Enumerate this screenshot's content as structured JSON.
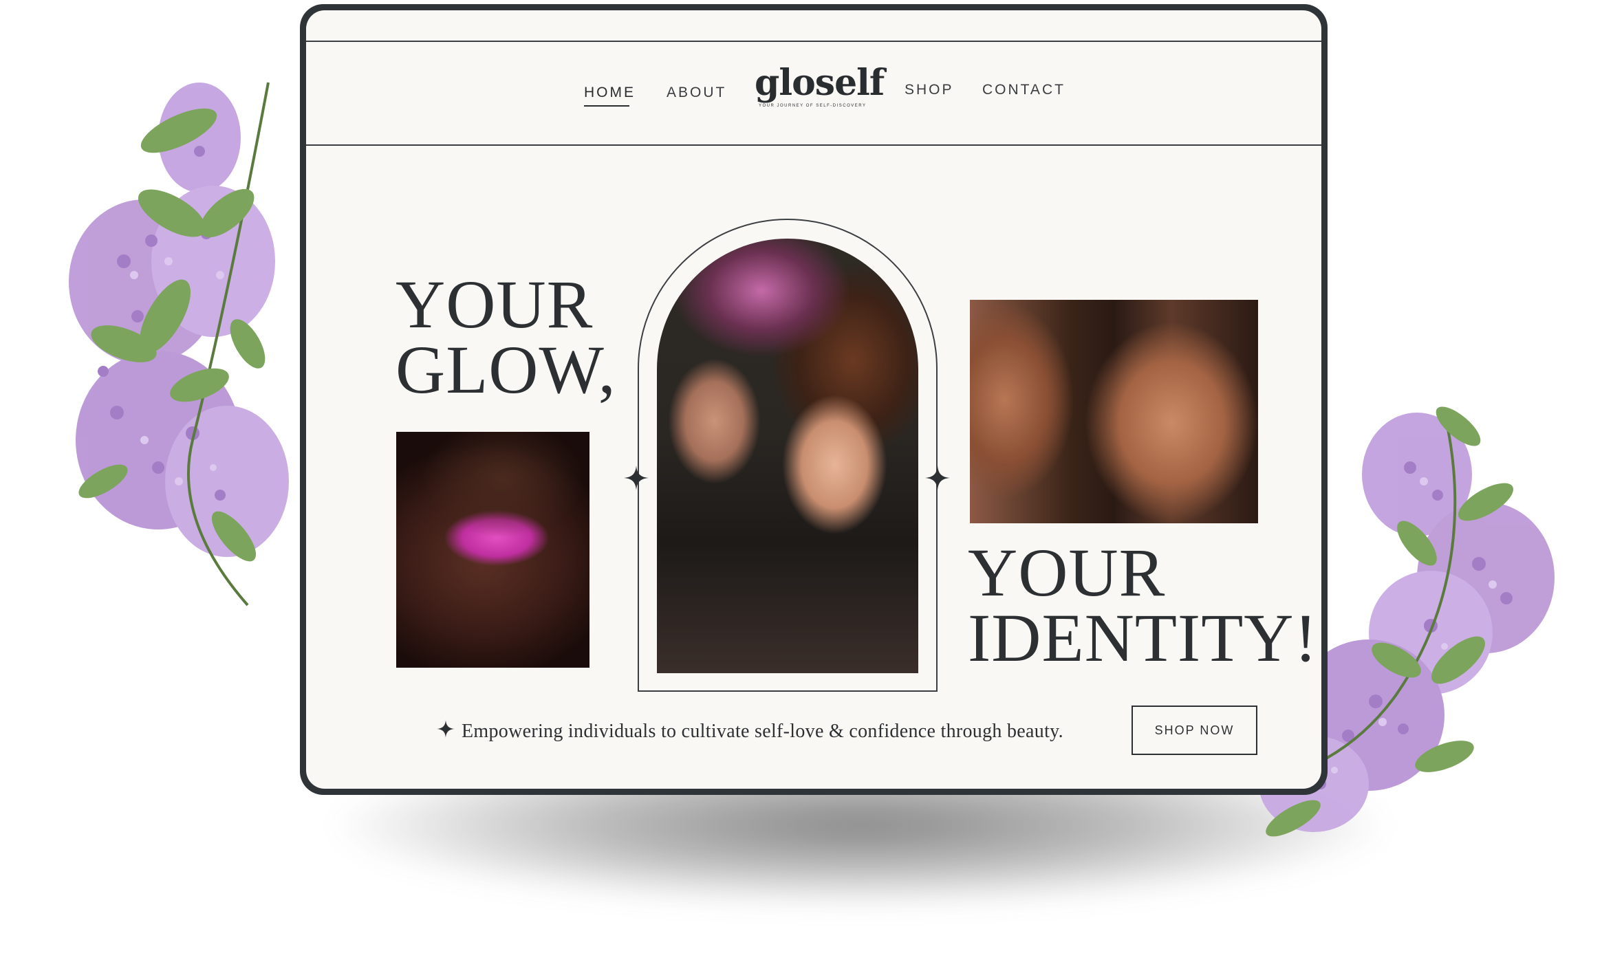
{
  "nav": {
    "home": "HOME",
    "about": "ABOUT",
    "shop": "SHOP",
    "contact": "CONTACT",
    "active": "HOME"
  },
  "logo": {
    "word": "gloself",
    "tagline": "YOUR JOURNEY OF SELF-DISCOVERY"
  },
  "hero": {
    "left_line1": "YOUR",
    "left_line2": "GLOW,",
    "right_line1": "YOUR",
    "right_line2": "IDENTITY!"
  },
  "tagline": "Empowering individuals to cultivate self-love & confidence through beauty.",
  "cta": "SHOP NOW",
  "colors": {
    "frame": "#2f3438",
    "background": "#faf8f5",
    "text": "#2d3033",
    "flowers": "#b48fd3",
    "leaves": "#7aa35a"
  },
  "icons": [
    "four-point-star-icon"
  ]
}
